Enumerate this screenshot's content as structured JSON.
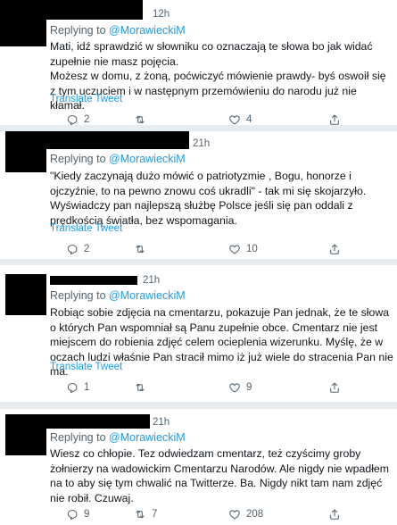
{
  "colors": {
    "background": "#e6ecf0",
    "card": "#ffffff",
    "link": "#1d9bf0",
    "muted": "#536471",
    "redaction": "#000000"
  },
  "common": {
    "replying_to": "Replying to ",
    "translate_label": "Translate Tweet"
  },
  "tweets": [
    {
      "time": "12h",
      "mention": "@MorawieckiM",
      "paragraphs": [
        "Mati, idź sprawdzić w słowniku co oznaczają te słowa bo jak widać zupełnie nie masz pojęcia.",
        "Możesz w domu, z żoną, poćwiczyć mówienie prawdy- byś oswoił się z tym uczuciem i w następnym przemówieniu do narodu już nie kłamał."
      ],
      "counts": {
        "replies": "2",
        "retweets": "",
        "likes": "4"
      }
    },
    {
      "time": "21h",
      "mention": "@MorawieckiM",
      "paragraphs": [
        "\"Kiedy zaczynają dużo mówić o patriotyzmie , Bogu, honorze i ojczyźnie, to na pewno znowu coś ukradli\" - tak mi się skojarzyło. Wyświadczy pan najlepszą służbę Polsce jeśli się pan oddali z prędkością światła, bez wspomagania."
      ],
      "counts": {
        "replies": "2",
        "retweets": "",
        "likes": "10"
      }
    },
    {
      "time": "21h",
      "mention": "@MorawieckiM",
      "paragraphs": [
        "Robiąc sobie zdjęcia na cmentarzu, pokazuje Pan jednak, że te słowa o których Pan wspomniał są Panu zupełnie obce. Cmentarz nie jest miejscem do robienia zdjęć celem ocieplenia wizerunku. Myślę, że w oczach ludzi właśnie Pan stracił mimo iż już wiele do stracenia Pan nie ma."
      ],
      "counts": {
        "replies": "1",
        "retweets": "",
        "likes": "9"
      }
    },
    {
      "time": "21h",
      "mention": "@MorawieckiM",
      "paragraphs": [
        "Wiesz co chłopie. Tez odwiedzam cmentarz, też czyścimy groby żołnierzy na wadowickim Cmentarzu Narodów. Ale nigdy nie wpadłem na to aby się tym chwalić na Twitterze. Ba. Nigdy nikt tam nam zdjęć nie robił. Czuwaj."
      ],
      "counts": {
        "replies": "9",
        "retweets": "7",
        "likes": "208"
      }
    }
  ]
}
